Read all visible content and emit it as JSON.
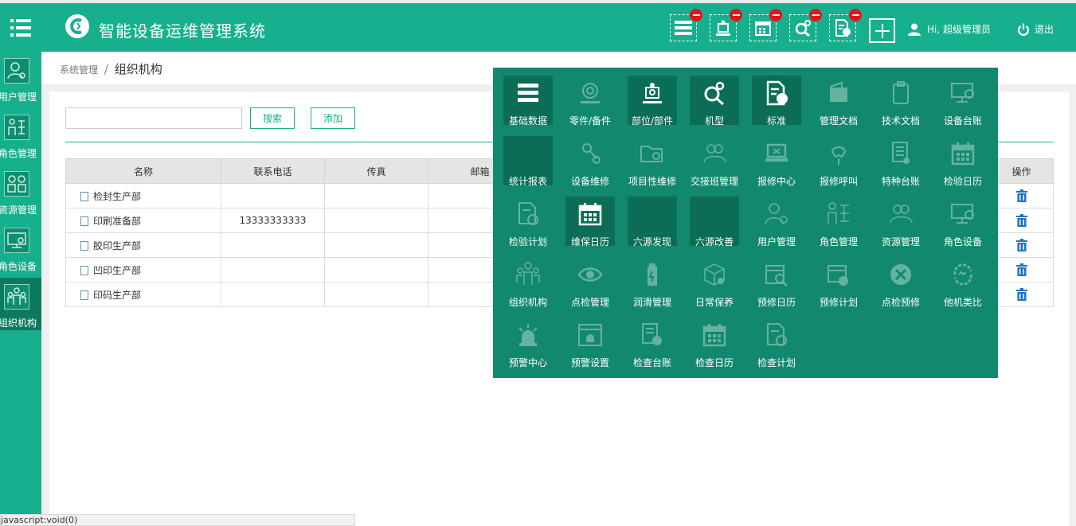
{
  "header": {
    "title": "智能设备运维管理系统",
    "greeting": "Hi, 超级管理员",
    "logout": "退出"
  },
  "sidebar": {
    "items": [
      {
        "label": "用户管理"
      },
      {
        "label": "角色管理"
      },
      {
        "label": "资源管理"
      },
      {
        "label": "角色设备"
      },
      {
        "label": "组织机构"
      }
    ]
  },
  "breadcrumb": {
    "parent": "系统管理",
    "separator": "/",
    "current": "组织机构"
  },
  "toolbar": {
    "search_value": "",
    "search_button": "搜索",
    "add_button": "添加"
  },
  "table": {
    "columns": [
      "名称",
      "联系电话",
      "传真",
      "邮箱",
      "操作"
    ],
    "rows": [
      {
        "name": "检封生产部",
        "phone": "",
        "fax": ""
      },
      {
        "name": "印刷准备部",
        "phone": "13333333333",
        "fax": ""
      },
      {
        "name": "胶印生产部",
        "phone": "",
        "fax": ""
      },
      {
        "name": "凹印生产部",
        "phone": "",
        "fax": ""
      },
      {
        "name": "印码生产部",
        "phone": "",
        "fax": ""
      }
    ]
  },
  "menu": {
    "tiles": [
      {
        "label": "基础数据",
        "active": true
      },
      {
        "label": "零件/备件",
        "active": false
      },
      {
        "label": "部位/部件",
        "active": true
      },
      {
        "label": "机型",
        "active": true
      },
      {
        "label": "标准",
        "active": true
      },
      {
        "label": "管理文档",
        "active": false
      },
      {
        "label": "技术文档",
        "active": false
      },
      {
        "label": "设备台账",
        "active": false
      },
      {
        "label": "统计报表",
        "active": true
      },
      {
        "label": "设备维修",
        "active": false
      },
      {
        "label": "项目性维修",
        "active": false
      },
      {
        "label": "交接班管理",
        "active": false
      },
      {
        "label": "报修中心",
        "active": false
      },
      {
        "label": "报修呼叫",
        "active": false
      },
      {
        "label": "特种台账",
        "active": false
      },
      {
        "label": "检验日历",
        "active": false
      },
      {
        "label": "检验计划",
        "active": false
      },
      {
        "label": "维保日历",
        "active": true
      },
      {
        "label": "六源发现",
        "active": true
      },
      {
        "label": "六源改善",
        "active": true
      },
      {
        "label": "用户管理",
        "active": false
      },
      {
        "label": "角色管理",
        "active": false
      },
      {
        "label": "资源管理",
        "active": false
      },
      {
        "label": "角色设备",
        "active": false
      },
      {
        "label": "组织机构",
        "active": false
      },
      {
        "label": "点检管理",
        "active": false
      },
      {
        "label": "润滑管理",
        "active": false
      },
      {
        "label": "日常保养",
        "active": false
      },
      {
        "label": "预修日历",
        "active": false
      },
      {
        "label": "预修计划",
        "active": false
      },
      {
        "label": "点检预修",
        "active": false
      },
      {
        "label": "他机类比",
        "active": false
      },
      {
        "label": "预警中心",
        "active": false
      },
      {
        "label": "预警设置",
        "active": false
      },
      {
        "label": "检查台账",
        "active": false
      },
      {
        "label": "检查日历",
        "active": false
      },
      {
        "label": "检查计划",
        "active": false
      }
    ]
  },
  "status_bar": "javascript:void(0)"
}
